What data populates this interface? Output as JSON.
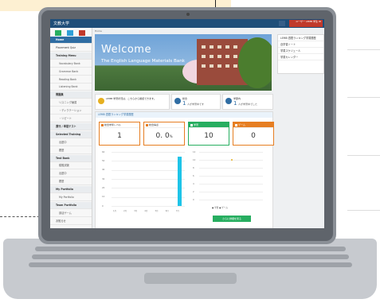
{
  "app": {
    "brand": "文教大学",
    "user": "ユーザー\nLEMB 学生 ID"
  },
  "breadcrumb": "Home",
  "sidebar": {
    "items": [
      {
        "label": "Home",
        "type": "head"
      },
      {
        "label": "Placement Quiz",
        "type": "item"
      },
      {
        "label": "Training Menu",
        "type": "head"
      },
      {
        "label": "Vocabulary Bank",
        "type": "sub"
      },
      {
        "label": "Grammar Bank",
        "type": "sub"
      },
      {
        "label": "Reading Bank",
        "type": "sub"
      },
      {
        "label": "Listening Bank",
        "type": "sub"
      },
      {
        "label": "問題集",
        "type": "head"
      },
      {
        "label": "リスニング練習",
        "type": "sub"
      },
      {
        "label": "・ディクテーション",
        "type": "sub"
      },
      {
        "label": "・リピート",
        "type": "sub"
      },
      {
        "label": "週刊 / 単語テスト",
        "type": "head"
      },
      {
        "label": "Selected Training",
        "type": "head"
      },
      {
        "label": "出題中",
        "type": "sub"
      },
      {
        "label": "履歴",
        "type": "sub"
      },
      {
        "label": "Test Bank",
        "type": "head"
      },
      {
        "label": "模擬試験",
        "type": "sub"
      },
      {
        "label": "出題中",
        "type": "sub"
      },
      {
        "label": "履歴",
        "type": "sub"
      },
      {
        "label": "My Portfolio",
        "type": "head"
      },
      {
        "label": "My Portfolio",
        "type": "sub"
      },
      {
        "label": "Team Portfolio",
        "type": "head"
      },
      {
        "label": "部活ゲーム",
        "type": "sub"
      },
      {
        "label": "お知らせ",
        "type": "item"
      }
    ]
  },
  "banner": {
    "title": "Welcome",
    "subtitle": "The English Language Materials Bank"
  },
  "right_panel": {
    "items": [
      "LEMB 週間ランキング学習履歴",
      "自学習ノート",
      "学習スケジュール",
      "学習カレンダー"
    ]
  },
  "info": [
    {
      "text": "LEMB 学習状況は、こちらから確認できます。",
      "value": "",
      "unit": ""
    },
    {
      "text": "総合",
      "value": "1",
      "unit": "人が学習中です"
    },
    {
      "text": "学部内",
      "value": "1",
      "unit": "人が学習中でした"
    }
  ],
  "stats": {
    "header": "LEMB 週間ランキング学習履歴",
    "cards": [
      {
        "label": "総合学年レベル",
        "value": "1",
        "small": ""
      },
      {
        "label": "総合得点",
        "value": "0. 0",
        "small": "%"
      },
      {
        "label": "学習",
        "value": "10",
        "small": ""
      },
      {
        "label": "ゲーム",
        "value": "0",
        "small": ""
      }
    ]
  },
  "button": {
    "label": "さらに詳細を見る"
  },
  "chart_data": [
    {
      "type": "bar",
      "categories": [
        "1月",
        "2月",
        "3月",
        "4月",
        "5月",
        "6月",
        "7月"
      ],
      "values": [
        0,
        0,
        0,
        0,
        0,
        0,
        55
      ],
      "ylim": [
        0,
        60
      ],
      "yticks": [
        0,
        10,
        20,
        30,
        40,
        50,
        60
      ],
      "ylabel": "",
      "title": ""
    },
    {
      "type": "scatter",
      "x": [
        3
      ],
      "y": [
        10
      ],
      "ylim": [
        0,
        12
      ],
      "yticks": [
        0,
        2,
        4,
        6,
        8,
        10,
        12
      ],
      "legend": "● 学習 ● ゲーム",
      "title": ""
    }
  ]
}
